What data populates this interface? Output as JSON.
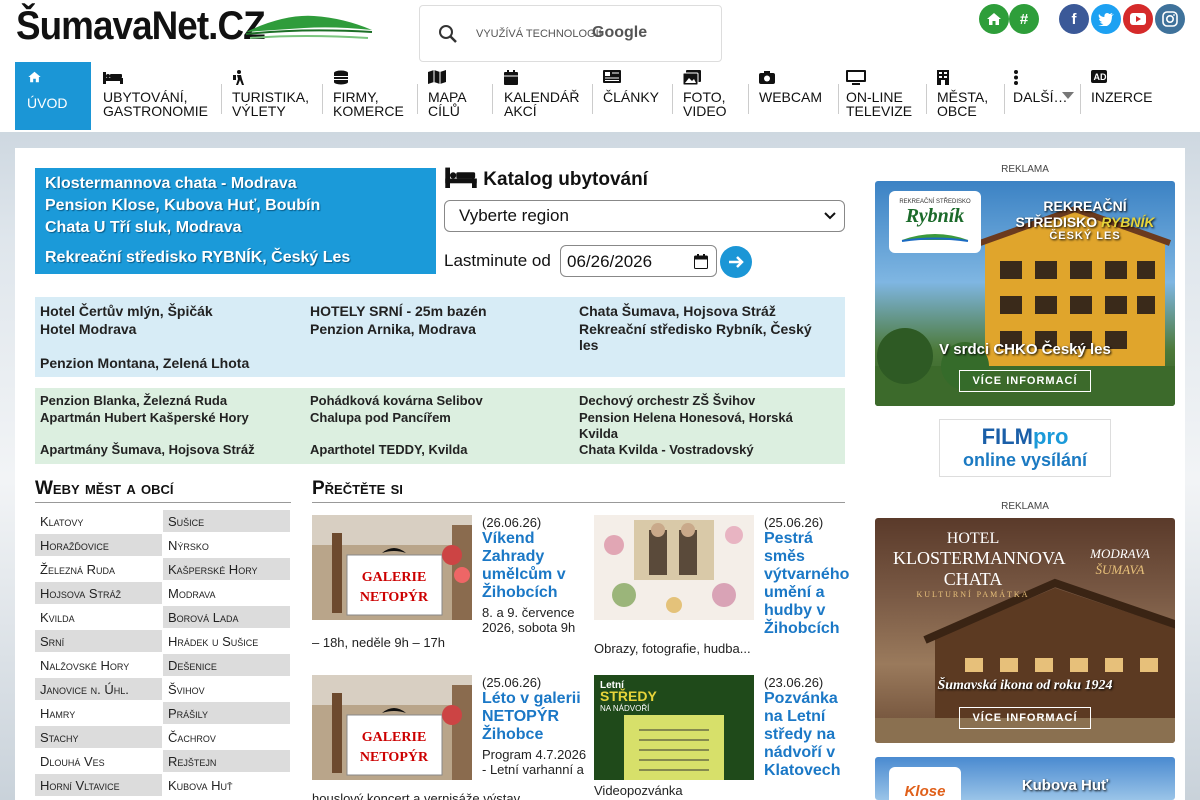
{
  "header": {
    "logo_text": "ŠumavaNet.CZ",
    "search_powered": "VYUŽÍVÁ TECHNOLOGII",
    "search_brand": "Google",
    "home_icon": "home-icon",
    "hash_label": "#"
  },
  "colors": {
    "accent": "#1b96d6",
    "green": "#2e9e3a",
    "facebook": "#3b5998",
    "twitter": "#1da1f2",
    "youtube": "#d52a2a",
    "instagram": "#3f729b"
  },
  "nav": [
    {
      "label": "Úvod",
      "icon": "home-icon"
    },
    {
      "label": "Ubytování, gastronomie",
      "icon": "bed-icon"
    },
    {
      "label": "Turistika, výlety",
      "icon": "hiker-icon"
    },
    {
      "label": "Firmy, komerce",
      "icon": "coins-icon"
    },
    {
      "label": "Mapa cílů",
      "icon": "map-icon"
    },
    {
      "label": "Kalendář akcí",
      "icon": "calendar-icon"
    },
    {
      "label": "Články",
      "icon": "newspaper-icon"
    },
    {
      "label": "Foto, video",
      "icon": "images-icon"
    },
    {
      "label": "Webcam",
      "icon": "camera-icon"
    },
    {
      "label": "On-line televize",
      "icon": "tv-icon"
    },
    {
      "label": "Města, obce",
      "icon": "building-icon"
    },
    {
      "label": "Další…",
      "icon": "dots-icon"
    },
    {
      "label": "Inzerce",
      "icon": "ad-icon"
    }
  ],
  "promo": [
    "Klostermannova chata - Modrava",
    "Pension Klose, Kubova Huť, Boubín",
    "Chata U Tří sluk, Modrava",
    "Rekreační středisko RYBNÍK, Český Les"
  ],
  "katalog": {
    "title": "Katalog ubytování",
    "region_placeholder": "Vyberte region",
    "lastminute_label": "Lastminute od",
    "date_value": "06/26/2026"
  },
  "grid1": [
    [
      "Hotel Čertův mlýn, Špičák",
      "HOTELY SRNÍ - 25m bazén",
      "Chata Šumava, Hojsova Stráž"
    ],
    [
      "Hotel Modrava",
      "Penzion Arnika, Modrava",
      "Rekreační středisko Rybník, Český les"
    ],
    [
      "Penzion Montana, Zelená Lhota",
      "",
      ""
    ]
  ],
  "grid2": [
    [
      "Penzion Blanka, Železná Ruda",
      "Pohádková kovárna Selibov",
      "Dechový orchestr ZŠ Švihov"
    ],
    [
      "Apartmán Hubert Kašperské Hory",
      "Chalupa pod Pancířem",
      "Pension Helena Honesová, Horská Kvilda"
    ],
    [
      "Apartmány Šumava, Hojsova Stráž",
      "Aparthotel TEDDY, Kvilda",
      "Chata Kvilda - Vostradovský"
    ]
  ],
  "cities_title": "Weby měst a obcí",
  "cities": [
    [
      "Klatovy",
      "Sušice"
    ],
    [
      "Horažďovice",
      "Nýrsko"
    ],
    [
      "Železná Ruda",
      "Kašperské Hory"
    ],
    [
      "Hojsova Stráž",
      "Modrava"
    ],
    [
      "Kvilda",
      "Borová Lada"
    ],
    [
      "Srní",
      "Hrádek u Sušice"
    ],
    [
      "Nalžovské Hory",
      "Dešenice"
    ],
    [
      "Janovice n. Úhl.",
      "Švihov"
    ],
    [
      "Hamry",
      "Prášily"
    ],
    [
      "Stachy",
      "Čachrov"
    ],
    [
      "Dlouhá Ves",
      "Rejštejn"
    ],
    [
      "Horní Vltavice",
      "Kubova Huť"
    ]
  ],
  "read_title": "Přečtěte si",
  "articles": [
    {
      "date": "(26.06.26)",
      "title": "Víkend Zahrady umělcům v Žihobcích",
      "desc1": "8. a 9. července 2026, sobota 9h",
      "desc2": "– 18h, neděle 9h – 17h",
      "img": "GALERIE NETOPÝR"
    },
    {
      "date": "(25.06.26)",
      "title": "Pestrá směs výtvarného umění a hudby v Žihobcích",
      "desc1": "Obrazy, fotografie, hudba...",
      "desc2": "",
      "img": ""
    },
    {
      "date": "(25.06.26)",
      "title": "Léto v galerii NETOPÝR Žihobce",
      "desc1": "Program 4.7.2026 - Letní varhanní a",
      "desc2": "houslový koncert a vernisáže výstav...",
      "img": "GALERIE NETOPÝR"
    },
    {
      "date": "(23.06.26)",
      "title": "Pozvánka na Letní středy na nádvoří v Klatovech",
      "desc1": "Videopozvánka",
      "desc2": "",
      "img": "Letní STŘEDY NA NÁDVOŘÍ"
    }
  ],
  "ads": {
    "label": "REKLAMA",
    "rybnik": {
      "logo_small": "REKREAČNÍ STŘEDISKO",
      "logo_big": "Rybník",
      "title1": "REKREAČNÍ",
      "title2a": "STŘEDISKO ",
      "title2b": "RYBNÍK",
      "title3": "ČESKÝ LES",
      "tagline": "V srdci CHKO Český les",
      "button": "VÍCE INFORMACÍ"
    },
    "filmpro": {
      "line1a": "FILM",
      "line1b": "pro",
      "line2": "online vysílání"
    },
    "kloster": {
      "hotel": "HOTEL",
      "name1": "KLOSTERMANNOVA",
      "name2": "CHATA",
      "sub": "KULTURNÍ PAMÁTKA",
      "loc1": "MODRAVA",
      "loc2": "ŠUMAVA",
      "tagline": "Šumavská ikona od roku 1924",
      "button": "VÍCE INFORMACÍ"
    },
    "kubova": {
      "logo": "Klose",
      "title": "Kubova Huť"
    }
  }
}
